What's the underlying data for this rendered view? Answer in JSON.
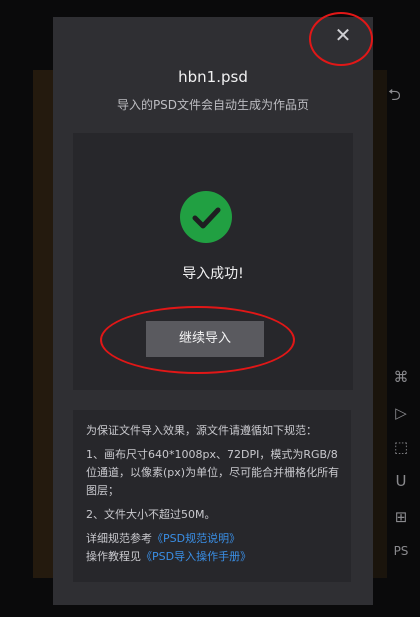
{
  "background": {
    "undo_icon": "undo-icon",
    "tools": [
      "crop-icon",
      "play-icon",
      "resize-icon",
      "magnet-icon",
      "grid-icon",
      "ps-icon"
    ],
    "ps_label": "PS"
  },
  "dialog": {
    "close_label": "✕",
    "file_name": "hbn1.psd",
    "subtitle": "导入的PSD文件会自动生成为作品页",
    "success_text": "导入成功!",
    "continue_label": "继续导入",
    "rules": {
      "intro": "为保证文件导入效果，源文件请遵循如下规范：",
      "rule1": "1、画布尺寸640*1008px、72DPI，模式为RGB/8位通道，以像素(px)为单位，尽可能合并栅格化所有图层；",
      "rule2": "2、文件大小不超过50M。",
      "spec_prefix": "详细规范参考",
      "spec_link": "《PSD规范说明》",
      "tutorial_prefix": "操作教程见",
      "tutorial_link": "《PSD导入操作手册》"
    }
  },
  "colors": {
    "accent_success": "#21a042",
    "link": "#3a8fe6",
    "annotation": "#e11717"
  }
}
